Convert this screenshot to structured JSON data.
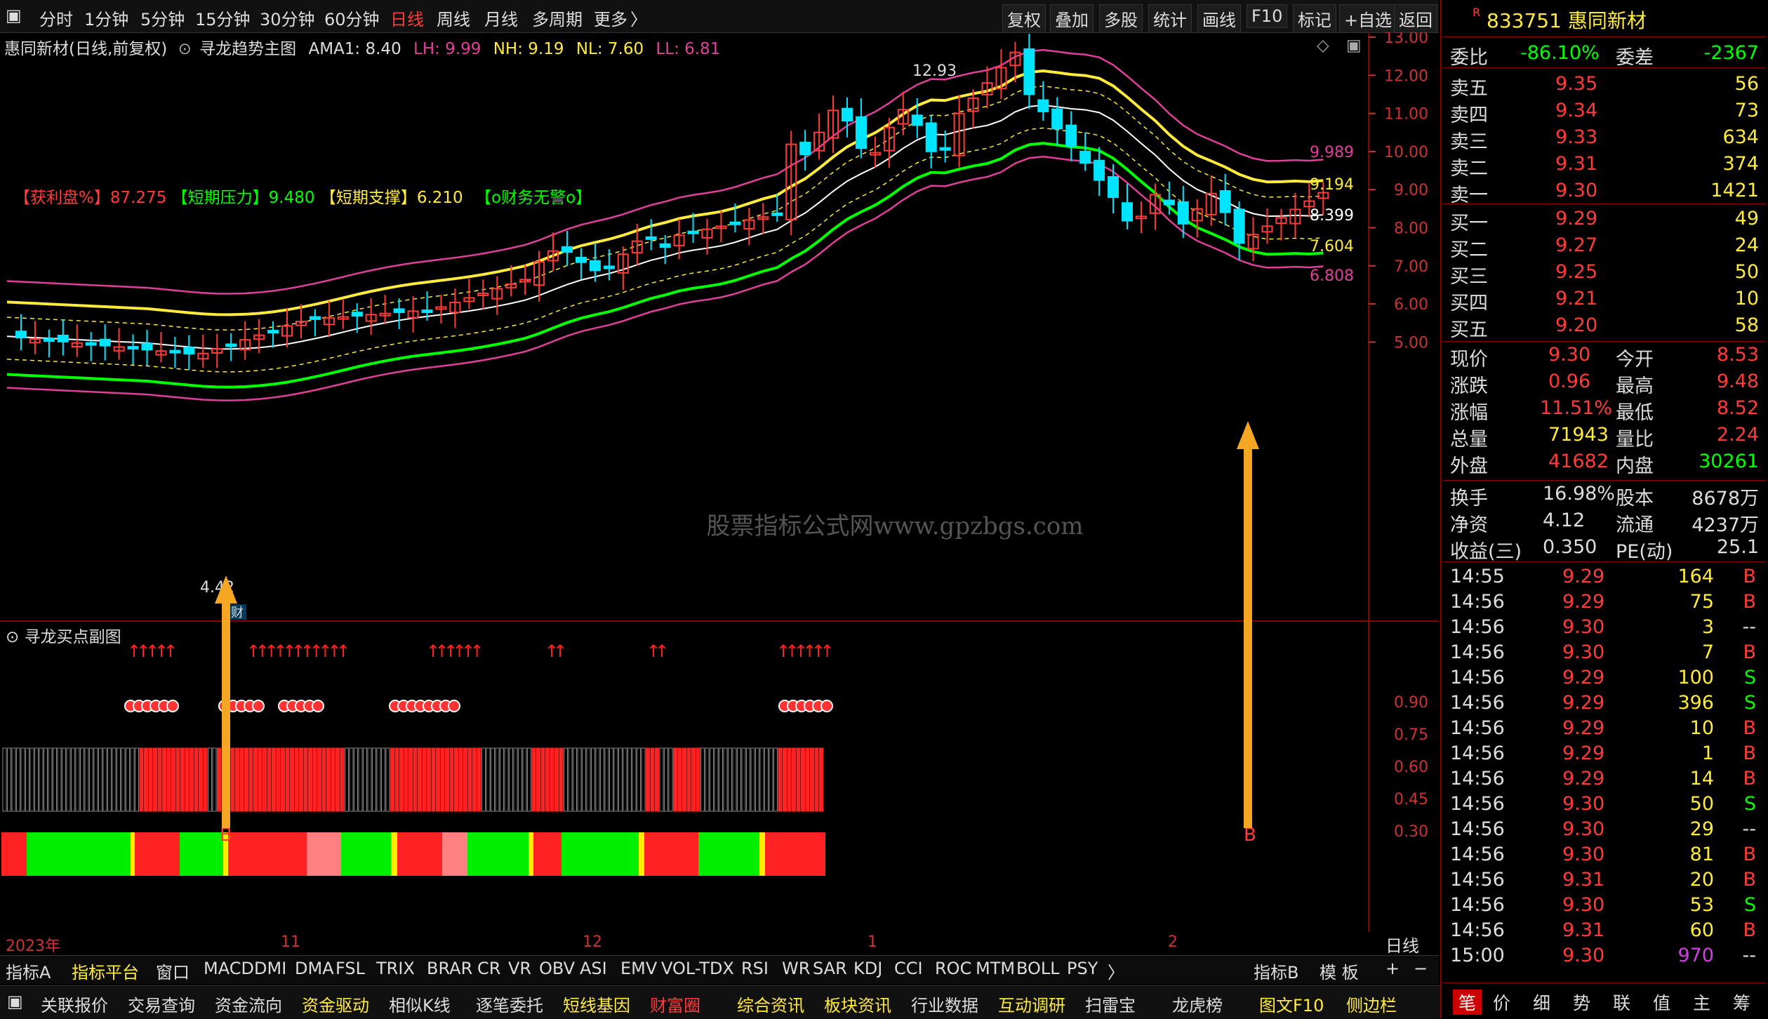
{
  "toolbar": {
    "periods": [
      "分时",
      "1分钟",
      "5分钟",
      "15分钟",
      "30分钟",
      "60分钟",
      "日线",
      "周线",
      "月线",
      "多周期",
      "更多"
    ],
    "active_period": "日线",
    "more_chevron": "〉",
    "buttons": [
      "复权",
      "叠加",
      "多股",
      "统计",
      "画线",
      "F10",
      "标记",
      "+自选",
      "返回"
    ]
  },
  "chart_header": {
    "stock_title": "惠同新材(日线,前复权)",
    "indicator_name": "寻龙趋势主图",
    "ama1": "AMA1: 8.40",
    "lh": "LH: 9.99",
    "nh": "NH: 9.19",
    "nl": "NL: 7.60",
    "ll": "LL: 6.81",
    "panel_labels": [
      "【获利盘%】87.275",
      "【短期压力】9.480",
      "【短期支撑】6.210",
      "【o财务无警o】"
    ]
  },
  "watermark": "股票指标公式网www.gpzbgs.com",
  "price_axis": [
    "13.00",
    "12.00",
    "11.00",
    "10.00",
    "9.00",
    "8.00",
    "7.00",
    "6.00",
    "5.00"
  ],
  "main_annotations": {
    "high_label": "12.93",
    "low_label": "4.42",
    "cai_badge": "财",
    "line_end_labels": [
      "9.989",
      "9.194",
      "8.399",
      "7.604",
      "6.808"
    ]
  },
  "sub_chart": {
    "title": "寻龙买点副图",
    "axis": [
      "0.90",
      "0.75",
      "0.60",
      "0.45",
      "0.30"
    ],
    "buy_label": "B"
  },
  "time_axis": {
    "year": "2023年",
    "months": [
      "11",
      "12",
      "1",
      "2"
    ],
    "period_button": "日线"
  },
  "tabs_row1": [
    "指标A",
    "指标平台",
    "窗口",
    "MACD",
    "DMI",
    "DMA",
    "FSL",
    "TRIX",
    "BRAR",
    "CR",
    "VR",
    "OBV",
    "ASI",
    "EMV",
    "VOL-TDX",
    "RSI",
    "WR",
    "SAR",
    "KDJ",
    "CCI",
    "ROC",
    "MTM",
    "BOLL",
    "PSY",
    "〉",
    "指标B",
    "模 板",
    "+",
    "−"
  ],
  "tabs_row2": [
    "关联报价",
    "交易查询",
    "资金流向",
    "资金驱动",
    "相似K线",
    "逐笔委托",
    "短线基因",
    "财富圈",
    "综合资讯",
    "板块资讯",
    "行业数据",
    "互动调研",
    "扫雷宝",
    "龙虎榜",
    "图文F10",
    "侧边栏"
  ],
  "quote": {
    "code": "833751",
    "name": "惠同新材",
    "r_mark": "R",
    "weibi_label": "委比",
    "weibi": "-86.10%",
    "weicha_label": "委差",
    "weicha": "-2367",
    "asks": [
      {
        "label": "卖五",
        "price": "9.35",
        "vol": "56"
      },
      {
        "label": "卖四",
        "price": "9.34",
        "vol": "73"
      },
      {
        "label": "卖三",
        "price": "9.33",
        "vol": "634"
      },
      {
        "label": "卖二",
        "price": "9.31",
        "vol": "374"
      },
      {
        "label": "卖一",
        "price": "9.30",
        "vol": "1421"
      }
    ],
    "bids": [
      {
        "label": "买一",
        "price": "9.29",
        "vol": "49"
      },
      {
        "label": "买二",
        "price": "9.27",
        "vol": "24"
      },
      {
        "label": "买三",
        "price": "9.25",
        "vol": "50"
      },
      {
        "label": "买四",
        "price": "9.21",
        "vol": "10"
      },
      {
        "label": "买五",
        "price": "9.20",
        "vol": "58"
      }
    ],
    "stats": [
      {
        "l1": "现价",
        "v1": "9.30",
        "l2": "今开",
        "v2": "8.53"
      },
      {
        "l1": "涨跌",
        "v1": "0.96",
        "l2": "最高",
        "v2": "9.48"
      },
      {
        "l1": "涨幅",
        "v1": "11.51%",
        "l2": "最低",
        "v2": "8.52"
      },
      {
        "l1": "总量",
        "v1": "71943",
        "l2": "量比",
        "v2": "2.24"
      },
      {
        "l1": "外盘",
        "v1": "41682",
        "l2": "内盘",
        "v2": "30261"
      }
    ],
    "stats2": [
      {
        "l1": "换手",
        "v1": "16.98%",
        "l2": "股本",
        "v2": "8678万"
      },
      {
        "l1": "净资",
        "v1": "4.12",
        "l2": "流通",
        "v2": "4237万"
      },
      {
        "l1": "收益(三)",
        "v1": "0.350",
        "l2": "PE(动)",
        "v2": "25.1"
      }
    ],
    "ticks": [
      {
        "t": "14:55",
        "p": "9.29",
        "v": "164",
        "s": "B"
      },
      {
        "t": "14:56",
        "p": "9.29",
        "v": "75",
        "s": "B"
      },
      {
        "t": "14:56",
        "p": "9.30",
        "v": "3",
        "s": "--"
      },
      {
        "t": "14:56",
        "p": "9.30",
        "v": "7",
        "s": "B"
      },
      {
        "t": "14:56",
        "p": "9.29",
        "v": "100",
        "s": "S"
      },
      {
        "t": "14:56",
        "p": "9.29",
        "v": "396",
        "s": "S"
      },
      {
        "t": "14:56",
        "p": "9.29",
        "v": "10",
        "s": "B"
      },
      {
        "t": "14:56",
        "p": "9.29",
        "v": "1",
        "s": "B"
      },
      {
        "t": "14:56",
        "p": "9.29",
        "v": "14",
        "s": "B"
      },
      {
        "t": "14:56",
        "p": "9.30",
        "v": "50",
        "s": "S"
      },
      {
        "t": "14:56",
        "p": "9.30",
        "v": "29",
        "s": "--"
      },
      {
        "t": "14:56",
        "p": "9.30",
        "v": "81",
        "s": "B"
      },
      {
        "t": "14:56",
        "p": "9.31",
        "v": "20",
        "s": "B"
      },
      {
        "t": "14:56",
        "p": "9.30",
        "v": "53",
        "s": "S"
      },
      {
        "t": "14:56",
        "p": "9.31",
        "v": "60",
        "s": "B"
      },
      {
        "t": "15:00",
        "p": "9.30",
        "v": "970",
        "s": "--"
      }
    ],
    "bottom_tabs": [
      "笔",
      "价",
      "细",
      "势",
      "联",
      "值",
      "主",
      "筹"
    ]
  },
  "colors": {
    "up": "#ff3b3b",
    "down": "#00e5ff",
    "green": "#00ff00",
    "yellow": "#ffeb3b",
    "magenta": "#e0409a"
  }
}
